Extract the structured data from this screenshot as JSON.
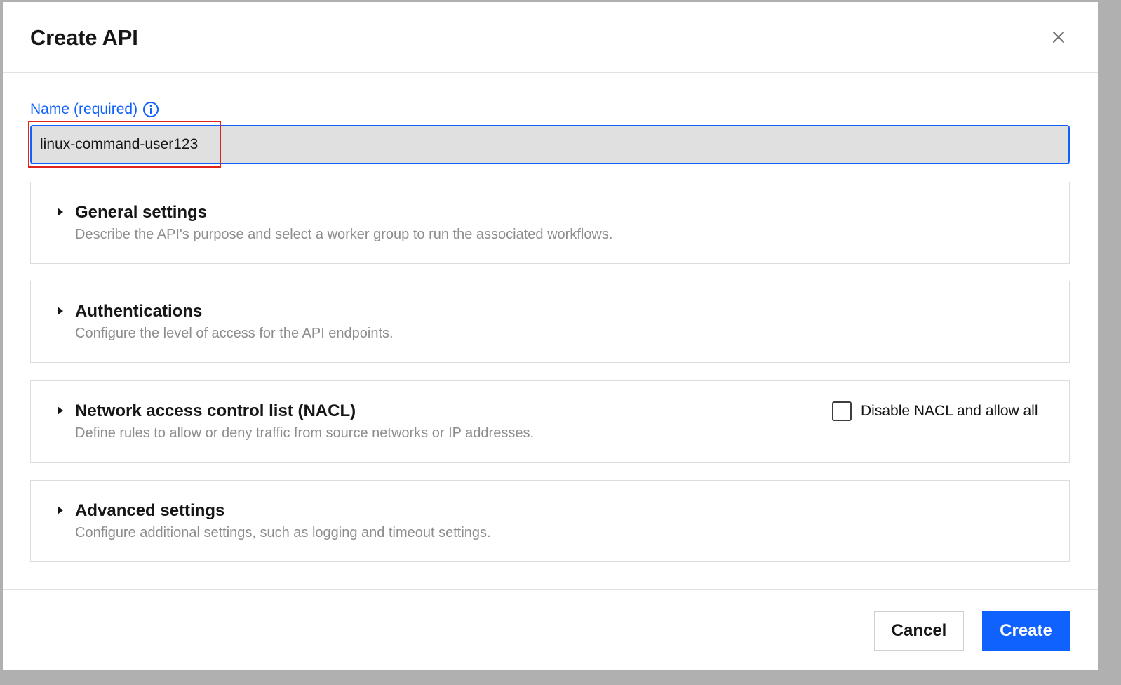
{
  "dialog": {
    "title": "Create API",
    "close_icon": "close-icon"
  },
  "name_field": {
    "label": "Name",
    "required_text": "(required)",
    "info_icon": "info-icon",
    "value": "linux-command-user123"
  },
  "sections": [
    {
      "title": "General settings",
      "description": "Describe the API's purpose and select a worker group to run the associated workflows.",
      "icon": "caret-right-icon"
    },
    {
      "title": "Authentications",
      "description": "Configure the level of access for the API endpoints.",
      "icon": "caret-right-icon"
    },
    {
      "title": "Network access control list (NACL)",
      "description": "Define rules to allow or deny traffic from source networks or IP addresses.",
      "icon": "caret-right-icon",
      "checkbox": {
        "label": "Disable NACL and allow all",
        "checked": false
      }
    },
    {
      "title": "Advanced settings",
      "description": "Configure additional settings, such as logging and timeout settings.",
      "icon": "caret-right-icon"
    }
  ],
  "footer": {
    "cancel_label": "Cancel",
    "create_label": "Create"
  },
  "colors": {
    "accent": "#0f62fe",
    "highlight": "#e2231a",
    "input_bg": "#e0e0e0",
    "muted_text": "#8d8d8d"
  }
}
